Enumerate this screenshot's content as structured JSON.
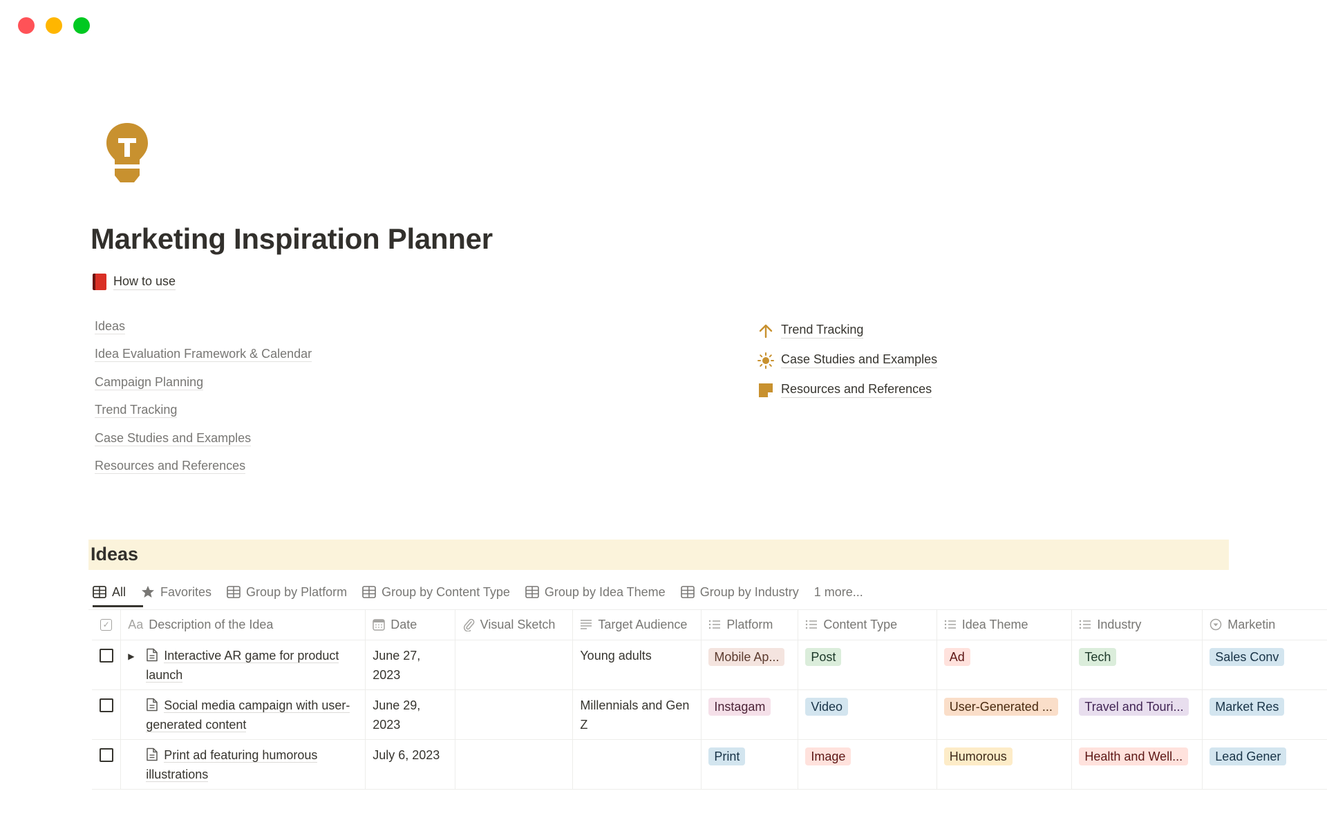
{
  "window": {
    "controls": [
      "close",
      "minimize",
      "maximize"
    ]
  },
  "page": {
    "icon": "lightbulb-t-icon",
    "title": "Marketing Inspiration Planner",
    "how_to_use": {
      "icon": "red-book-icon",
      "label": "How to use"
    }
  },
  "toc": {
    "items": [
      {
        "label": "Ideas"
      },
      {
        "label": "Idea Evaluation Framework & Calendar"
      },
      {
        "label": "Campaign Planning"
      },
      {
        "label": "Trend Tracking"
      },
      {
        "label": "Case Studies and Examples"
      },
      {
        "label": "Resources and References"
      }
    ]
  },
  "links": {
    "items": [
      {
        "icon": "arrow-up-icon",
        "label": "Trend Tracking"
      },
      {
        "icon": "sun-icon",
        "label": "Case Studies and Examples"
      },
      {
        "icon": "sticky-note-icon",
        "label": "Resources and References"
      }
    ],
    "icon_color": "#c8912f"
  },
  "database": {
    "title": "Ideas",
    "band_color": "#fbf3db",
    "tabs": [
      {
        "icon": "table-icon",
        "label": "All",
        "active": true
      },
      {
        "icon": "star-icon",
        "label": "Favorites"
      },
      {
        "icon": "table-icon",
        "label": "Group by Platform"
      },
      {
        "icon": "table-icon",
        "label": "Group by Content Type"
      },
      {
        "icon": "table-icon",
        "label": "Group by Idea Theme"
      },
      {
        "icon": "table-icon",
        "label": "Group by Industry"
      },
      {
        "icon": "",
        "label": "1 more..."
      }
    ],
    "columns": [
      {
        "icon": "checkbox-icon",
        "label": ""
      },
      {
        "icon": "title-aa-icon",
        "label": "Description of the Idea",
        "icon_text": "Aa"
      },
      {
        "icon": "calendar-icon",
        "label": "Date"
      },
      {
        "icon": "paperclip-icon",
        "label": "Visual Sketch"
      },
      {
        "icon": "text-lines-icon",
        "label": "Target Audience"
      },
      {
        "icon": "multi-select-icon",
        "label": "Platform"
      },
      {
        "icon": "multi-select-icon",
        "label": "Content Type"
      },
      {
        "icon": "multi-select-icon",
        "label": "Idea Theme"
      },
      {
        "icon": "multi-select-icon",
        "label": "Industry"
      },
      {
        "icon": "select-icon",
        "label": "Marketin"
      }
    ],
    "rows": [
      {
        "checked": false,
        "has_toggle": true,
        "title": "Interactive AR game for product launch",
        "date": "June 27, 2023",
        "visual_sketch": "",
        "target_audience": "Young adults",
        "platform": {
          "label": "Mobile Ap...",
          "bg": "#f4e4df",
          "fg": "#5c3b2e"
        },
        "content_type": {
          "label": "Post",
          "bg": "#dbeddb",
          "fg": "#1c3829"
        },
        "idea_theme": {
          "label": "Ad",
          "bg": "#ffe2dd",
          "fg": "#5d1715"
        },
        "industry": {
          "label": "Tech",
          "bg": "#dbeddb",
          "fg": "#1c3829"
        },
        "marketing": {
          "label": "Sales Conv",
          "bg": "#d3e5ef",
          "fg": "#183347"
        }
      },
      {
        "checked": false,
        "has_toggle": false,
        "title": "Social media campaign with user-generated content",
        "date": "June 29, 2023",
        "visual_sketch": "",
        "target_audience": "Millennials and Gen Z",
        "platform": {
          "label": "Instagam",
          "bg": "#f5e0e9",
          "fg": "#4c2337"
        },
        "content_type": {
          "label": "Video",
          "bg": "#d3e5ef",
          "fg": "#183347"
        },
        "idea_theme": {
          "label": "User-Generated ...",
          "bg": "#fadec9",
          "fg": "#49290e"
        },
        "industry": {
          "label": "Travel and Touri...",
          "bg": "#e8deee",
          "fg": "#412454"
        },
        "marketing": {
          "label": "Market Res",
          "bg": "#d3e5ef",
          "fg": "#183347"
        }
      },
      {
        "checked": false,
        "has_toggle": false,
        "title": "Print ad featuring humorous illustrations",
        "date": "July 6, 2023",
        "visual_sketch": "",
        "target_audience": "",
        "platform": {
          "label": "Print",
          "bg": "#d3e5ef",
          "fg": "#183347"
        },
        "content_type": {
          "label": "Image",
          "bg": "#ffe2dd",
          "fg": "#5d1715"
        },
        "idea_theme": {
          "label": "Humorous",
          "bg": "#fdecc8",
          "fg": "#402c1b"
        },
        "industry": {
          "label": "Health and Well...",
          "bg": "#ffe2dd",
          "fg": "#5d1715"
        },
        "marketing": {
          "label": "Lead Gener",
          "bg": "#d3e5ef",
          "fg": "#183347"
        }
      }
    ]
  }
}
